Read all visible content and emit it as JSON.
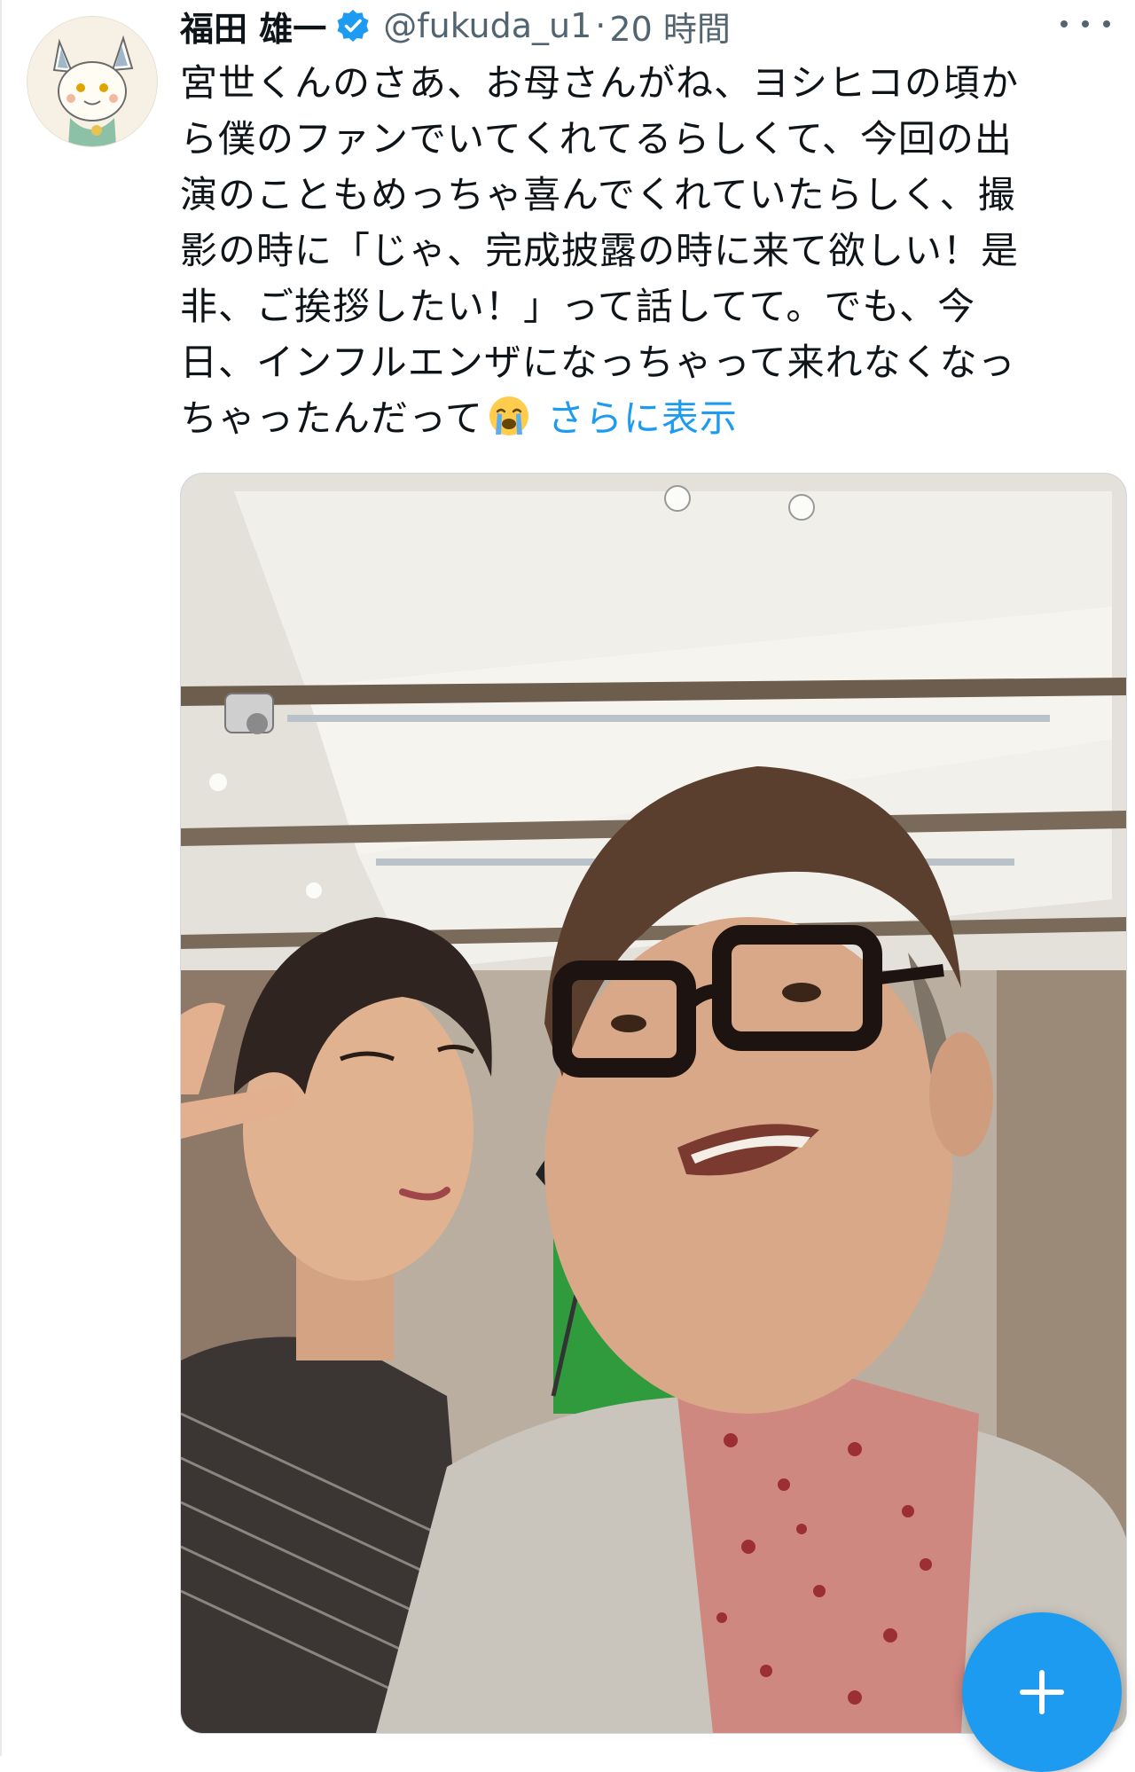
{
  "tweet": {
    "author": {
      "display_name": "福田 雄一",
      "handle": "@fukuda_u1",
      "separator": "·",
      "time": "20 時間",
      "verified": true
    },
    "text_lines": [
      "宮世くんのさあ、お母さんがね、ヨシヒコの頃か",
      "ら僕のファンでいてくれてるらしくて、今回の出",
      "演のこともめっちゃ喜んでくれていたらしく、撮",
      "影の時に「じゃ、完成披露の時に来て欲しい！是",
      "非、ご挨拶したい！」って話してて。でも、今",
      "日、インフルエンザになっちゃって来れなくなっ",
      "ちゃったんだって"
    ],
    "emoji": "loudly-crying-face",
    "show_more": "さらに表示"
  },
  "icons": {
    "more": "more-horizontal-icon",
    "verified": "verified-badge-icon",
    "compose": "plus-icon"
  },
  "colors": {
    "accent": "#1d9bf0",
    "text": "#0f1419",
    "secondary": "#536471"
  }
}
